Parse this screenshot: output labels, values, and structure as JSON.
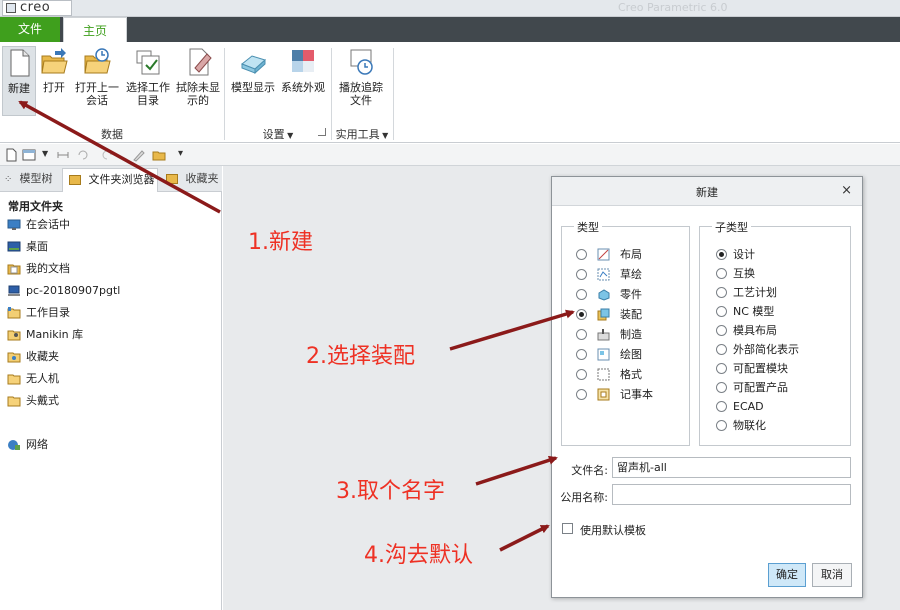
{
  "window": {
    "app_name": "creo",
    "title": "Creo Parametric 6.0"
  },
  "tabs": [
    {
      "label": "文件",
      "active": false
    },
    {
      "label": "主页",
      "active": true
    }
  ],
  "ribbon": {
    "buttons": {
      "new": "新建",
      "open": "打开",
      "open_last_session_l1": "打开上一",
      "open_last_session_l2": "会话",
      "select_workdir_l1": "选择工作",
      "select_workdir_l2": "目录",
      "erase_l1": "拭除未显",
      "erase_l2": "示的",
      "model_display": "模型显示",
      "system_appearance": "系统外观",
      "play_trail_l1": "播放追踪",
      "play_trail_l2": "文件"
    },
    "groups": {
      "data": "数据",
      "settings": "设置",
      "utilities": "实用工具"
    }
  },
  "navigator": {
    "tabs": [
      "模型树",
      "文件夹浏览器",
      "收藏夹"
    ],
    "heading": "常用文件夹",
    "folders": [
      {
        "label": "在会话中",
        "icon": "session-icon"
      },
      {
        "label": "桌面",
        "icon": "desktop-icon"
      },
      {
        "label": "我的文档",
        "icon": "documents-icon"
      },
      {
        "label": "pc-20180907pgtl",
        "icon": "computer-icon"
      },
      {
        "label": "工作目录",
        "icon": "workdir-icon"
      },
      {
        "label": "Manikin 库",
        "icon": "manikin-icon"
      },
      {
        "label": "收藏夹",
        "icon": "favorites-icon"
      },
      {
        "label": "无人机",
        "icon": "folder-icon"
      },
      {
        "label": "头戴式",
        "icon": "folder-icon"
      },
      {
        "label": "网络",
        "icon": "network-icon"
      }
    ]
  },
  "dialog": {
    "title": "新建",
    "close": "×",
    "type_legend": "类型",
    "subtype_legend": "子类型",
    "types": [
      {
        "label": "布局",
        "selected": false,
        "icon": "layout-icon"
      },
      {
        "label": "草绘",
        "selected": false,
        "icon": "sketch-icon"
      },
      {
        "label": "零件",
        "selected": false,
        "icon": "part-icon"
      },
      {
        "label": "装配",
        "selected": true,
        "icon": "assembly-icon"
      },
      {
        "label": "制造",
        "selected": false,
        "icon": "manufacturing-icon"
      },
      {
        "label": "绘图",
        "selected": false,
        "icon": "drawing-icon"
      },
      {
        "label": "格式",
        "selected": false,
        "icon": "format-icon"
      },
      {
        "label": "记事本",
        "selected": false,
        "icon": "notebook-icon"
      }
    ],
    "subtypes": [
      {
        "label": "设计",
        "selected": true
      },
      {
        "label": "互换",
        "selected": false
      },
      {
        "label": "工艺计划",
        "selected": false
      },
      {
        "label": "NC 模型",
        "selected": false
      },
      {
        "label": "模具布局",
        "selected": false
      },
      {
        "label": "外部简化表示",
        "selected": false
      },
      {
        "label": "可配置模块",
        "selected": false
      },
      {
        "label": "可配置产品",
        "selected": false
      },
      {
        "label": "ECAD",
        "selected": false
      },
      {
        "label": "物联化",
        "selected": false
      }
    ],
    "filename_label": "文件名:",
    "filename_value": "留声机-all",
    "common_name_label": "公用名称:",
    "common_name_value": "",
    "use_default_template_label": "使用默认模板",
    "use_default_template_checked": false,
    "ok": "确定",
    "cancel": "取消"
  },
  "annotations": {
    "step1": "1.新建",
    "step2": "2.选择装配",
    "step3": "3.取个名字",
    "step4": "4.沟去默认",
    "color": "#ee3124"
  }
}
